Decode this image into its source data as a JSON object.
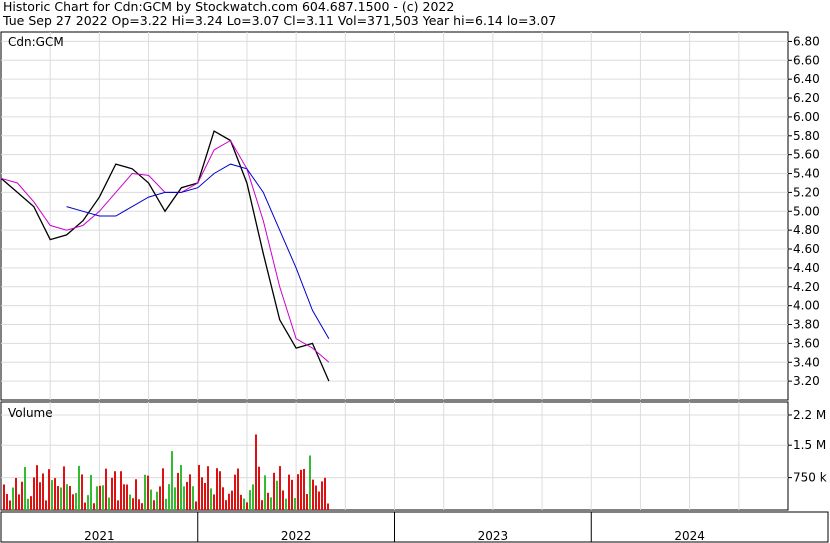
{
  "header": {
    "line1": "Historic Chart for Cdn:GCM by Stockwatch.com 604.687.1500 - (c) 2022",
    "line2": "Tue Sep 27 2022  Op=3.22  Hi=3.24  Lo=3.07  Cl=3.11  Vol=371,503  Year hi=6.14  lo=3.07"
  },
  "chart_data": [
    {
      "type": "line",
      "title": "Cdn:GCM",
      "ylim": [
        3.0,
        6.9
      ],
      "yticks": [
        "6.80",
        "6.60",
        "6.40",
        "6.20",
        "6.00",
        "5.80",
        "5.60",
        "5.40",
        "5.20",
        "5.00",
        "4.80",
        "4.60",
        "4.40",
        "4.20",
        "4.00",
        "3.80",
        "3.60",
        "3.40",
        "3.20"
      ],
      "x": [
        "2021-01",
        "2021-02",
        "2021-03",
        "2021-04",
        "2021-05",
        "2021-06",
        "2021-07",
        "2021-08",
        "2021-09",
        "2021-10",
        "2021-11",
        "2021-12",
        "2022-01",
        "2022-02",
        "2022-03",
        "2022-04",
        "2022-05",
        "2022-06",
        "2022-07",
        "2022-08",
        "2022-09"
      ],
      "series": [
        {
          "values": [
            5.35,
            5.2,
            5.05,
            4.7,
            4.75,
            4.9,
            5.15,
            5.5,
            5.45,
            5.3,
            5.0,
            5.25,
            5.3,
            5.85,
            5.75,
            5.3,
            4.55,
            3.85,
            3.55,
            3.6,
            3.2
          ],
          "color": "#000000"
        },
        {
          "values": [
            5.35,
            5.3,
            5.1,
            4.85,
            4.8,
            4.85,
            5.0,
            5.2,
            5.4,
            5.38,
            5.2,
            5.2,
            5.3,
            5.65,
            5.75,
            5.45,
            4.9,
            4.2,
            3.65,
            3.55,
            3.4
          ],
          "color": "#cc00cc"
        },
        {
          "values": [
            null,
            null,
            null,
            null,
            5.05,
            5.0,
            4.95,
            4.95,
            5.05,
            5.15,
            5.2,
            5.2,
            5.25,
            5.4,
            5.5,
            5.45,
            5.2,
            4.8,
            4.4,
            3.95,
            3.65
          ],
          "color": "#0000cc"
        }
      ]
    },
    {
      "type": "bar",
      "title": "Volume",
      "yticks": [
        "2.2 M",
        "1.5 M",
        "750 k"
      ],
      "ylim": [
        0,
        2500000
      ]
    }
  ],
  "x_axis": {
    "years": [
      "2021",
      "2022",
      "2023",
      "2024"
    ]
  }
}
